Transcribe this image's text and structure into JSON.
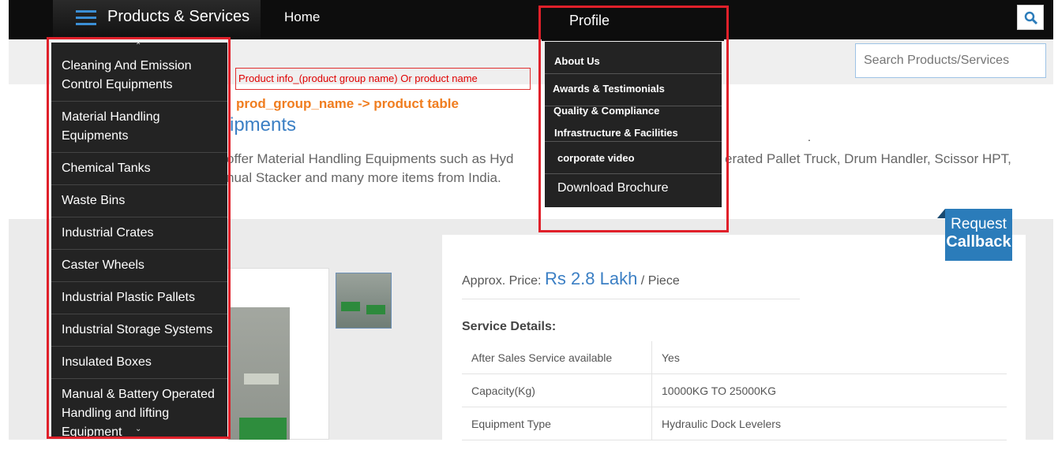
{
  "topbar": {
    "products_services": "Products & Services",
    "home": "Home",
    "search_placeholder": "Search Products/Services"
  },
  "annotations": {
    "box_text": "Product info_(product group name) Or product name",
    "orange_text": "prod_group_name -> product table"
  },
  "page": {
    "title_fragment": "ipments",
    "desc_line1": "offer Material Handling Equipments such as Hyd",
    "desc_line1_right": "erated Pallet Truck, Drum Handler, Scissor HPT,",
    "desc_line2": "nual Stacker and many more items from India."
  },
  "left_menu": {
    "items": [
      "Cleaning And Emission Control Equipments",
      "Material Handling Equipments",
      "Chemical Tanks",
      "Waste Bins",
      "Industrial Crates",
      "Caster Wheels",
      "Industrial Plastic Pallets",
      "Industrial Storage Systems",
      "Insulated Boxes",
      "Manual & Battery Operated Handling and lifting Equipment"
    ]
  },
  "profile_menu": {
    "label": "Profile",
    "items": [
      "About Us",
      "Awards & Testimonials",
      "Quality & Compliance",
      "Infrastructure & Facilities",
      "corporate video",
      "Download Brochure"
    ]
  },
  "details": {
    "price_label": "Approx. Price:",
    "price_value": "Rs 2.8 Lakh",
    "price_unit": "/ Piece",
    "service_heading": "Service Details:",
    "rows": [
      [
        "After Sales Service available",
        "Yes"
      ],
      [
        "Capacity(Kg)",
        "10000KG TO 25000KG"
      ],
      [
        "Equipment Type",
        "Hydraulic Dock Levelers"
      ]
    ]
  },
  "callback": {
    "line1": "Request",
    "line2": "Callback"
  },
  "colors": {
    "accent_blue": "#3b7fc4",
    "highlight_red": "#e0202a",
    "orange": "#f07d1f"
  }
}
